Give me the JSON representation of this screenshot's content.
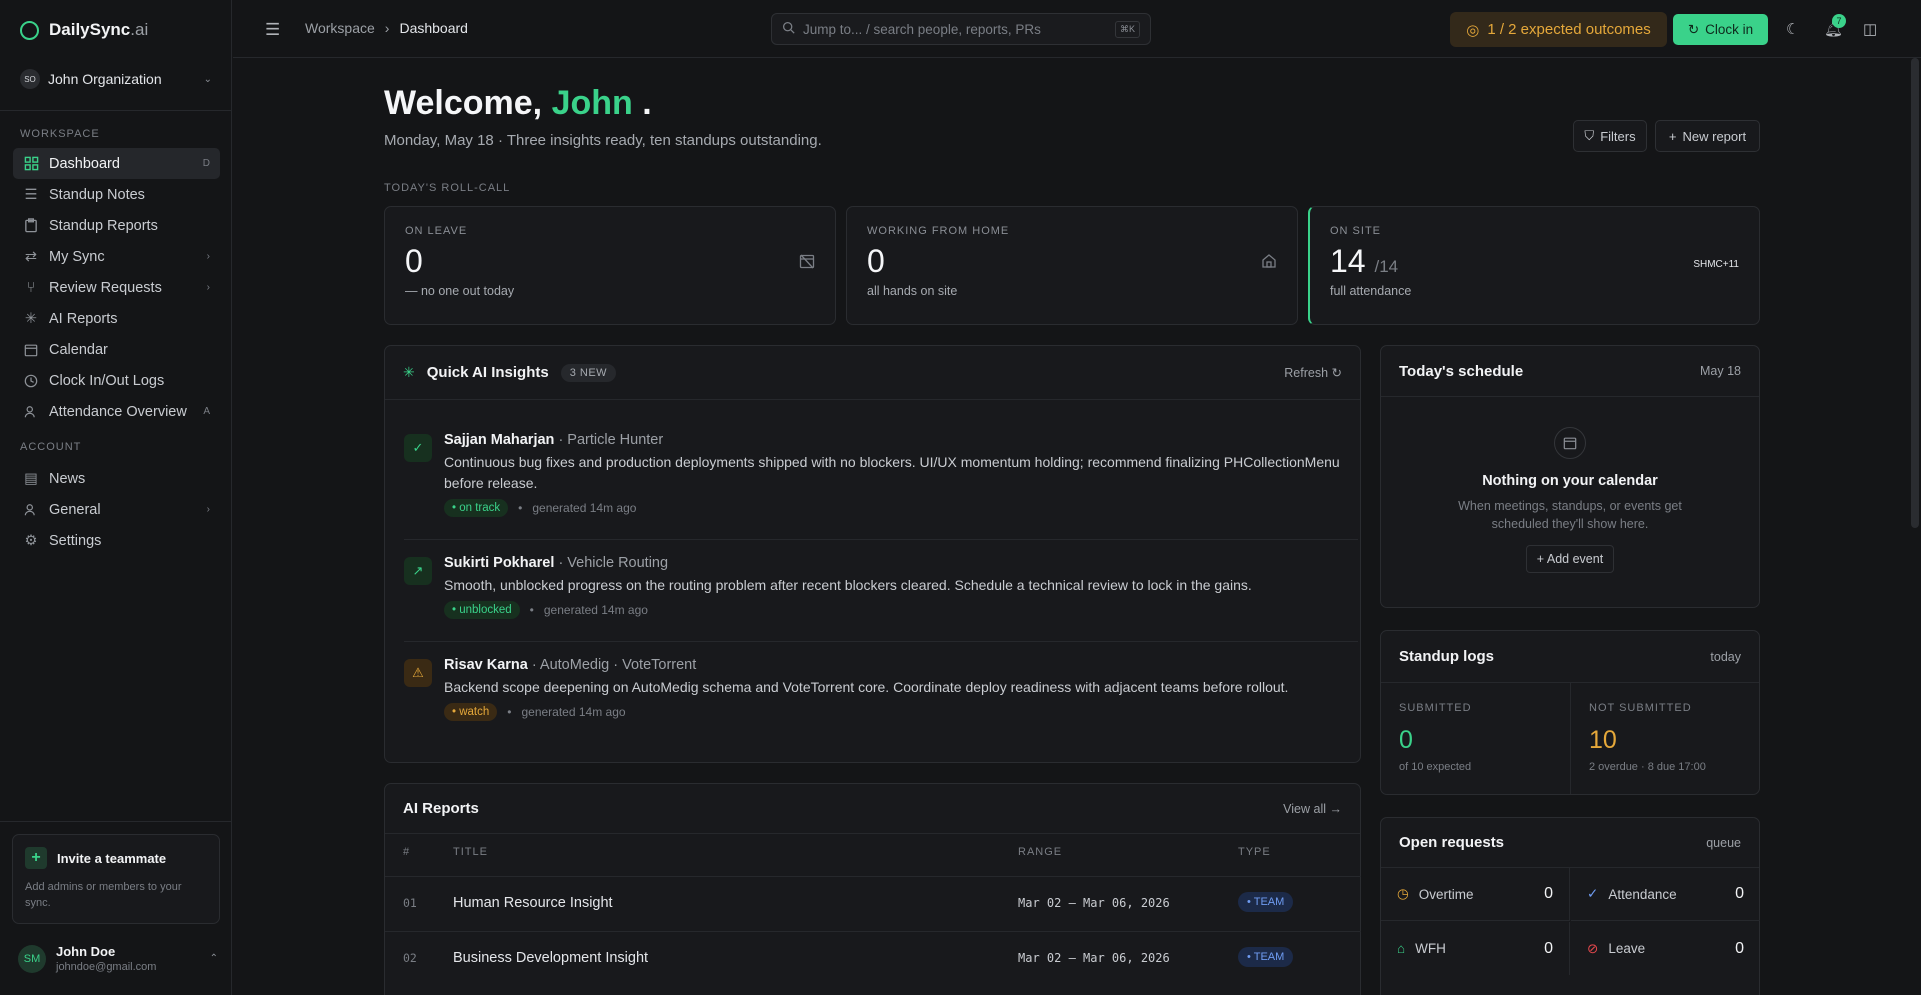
{
  "brand": {
    "name": "DailySync",
    "suffix": ".ai"
  },
  "org": {
    "initials": "SO",
    "name": "John Organization"
  },
  "sidebar": {
    "workspace_label": "WORKSPACE",
    "items": [
      {
        "label": "Dashboard",
        "tail": "D"
      },
      {
        "label": "Standup Notes",
        "tail": ""
      },
      {
        "label": "Standup Reports",
        "tail": ""
      },
      {
        "label": "My Sync",
        "tail": "›"
      },
      {
        "label": "Review Requests",
        "tail": "›"
      },
      {
        "label": "AI Reports",
        "tail": ""
      },
      {
        "label": "Calendar",
        "tail": ""
      },
      {
        "label": "Clock In/Out Logs",
        "tail": ""
      },
      {
        "label": "Attendance Overview",
        "tail": "A"
      }
    ],
    "account_label": "ACCOUNT",
    "account_items": [
      {
        "label": "News",
        "tail": ""
      },
      {
        "label": "General",
        "tail": "›"
      },
      {
        "label": "Settings",
        "tail": ""
      }
    ],
    "invite": {
      "title": "Invite a teammate",
      "desc": "Add admins or members to your sync."
    },
    "user": {
      "initials": "SM",
      "name": "John Doe",
      "email": "johndoe@gmail.com"
    }
  },
  "topbar": {
    "breadcrumb": [
      "Workspace",
      "Dashboard"
    ],
    "search_placeholder": "Jump to...  / search people, reports, PRs",
    "search_kbd": "⌘K",
    "outcomes": "1 / 2 expected outcomes",
    "clockin": "Clock in",
    "notif_count": "7"
  },
  "welcome": {
    "greeting": "Welcome,",
    "name": "John",
    "punct": ".",
    "subtitle": "Monday, May 18 · Three insights ready, ten standups outstanding."
  },
  "actions": {
    "filters": "Filters",
    "new_report": "New report"
  },
  "rollcall": {
    "label": "TODAY'S ROLL-CALL",
    "cards": [
      {
        "label": "ON LEAVE",
        "value": "0",
        "of": "",
        "note": "— no one out today"
      },
      {
        "label": "WORKING FROM HOME",
        "value": "0",
        "of": "",
        "note": "all hands on site"
      },
      {
        "label": "ON SITE",
        "value": "14",
        "of": "/14",
        "note": "full attendance",
        "avatars": "SHMC+11"
      }
    ]
  },
  "insights": {
    "title": "Quick AI Insights",
    "chip": "3 NEW",
    "refresh": "Refresh",
    "items": [
      {
        "name": "Sajjan Maharjan",
        "project": "· Particle Hunter",
        "text": "Continuous bug fixes and production deployments shipped with no blockers. UI/UX momentum holding; recommend finalizing PHCollectionMenu before release.",
        "tag": "on track",
        "time": "generated 14m ago"
      },
      {
        "name": "Sukirti Pokharel",
        "project": "· Vehicle Routing",
        "text": "Smooth, unblocked progress on the routing problem after recent blockers cleared. Schedule a technical review to lock in the gains.",
        "tag": "unblocked",
        "time": "generated 14m ago"
      },
      {
        "name": "Risav Karna",
        "project": "· AutoMedig · VoteTorrent",
        "text": "Backend scope deepening on AutoMedig schema and VoteTorrent core. Coordinate deploy readiness with adjacent teams before rollout.",
        "tag": "watch",
        "time": "generated 14m ago"
      }
    ]
  },
  "reports": {
    "title": "AI Reports",
    "view_all": "View all →",
    "columns": [
      "#",
      "TITLE",
      "RANGE",
      "TYPE"
    ],
    "rows": [
      {
        "n": "01",
        "title": "Human Resource Insight",
        "range": "Mar 02 — Mar 06, 2026",
        "type": "TEAM"
      },
      {
        "n": "02",
        "title": "Business Development Insight",
        "range": "Mar 02 — Mar 06, 2026",
        "type": "TEAM"
      }
    ]
  },
  "schedule": {
    "title": "Today's schedule",
    "date": "May 18",
    "empty_title": "Nothing on your calendar",
    "empty_desc": "When meetings, standups, or events get scheduled they'll show here.",
    "add": "+ Add event"
  },
  "standup": {
    "title": "Standup logs",
    "when": "today",
    "submitted_label": "SUBMITTED",
    "submitted": "0",
    "submitted_note": "of 10 expected",
    "not_label": "NOT SUBMITTED",
    "not": "10",
    "not_note": "2 overdue · 8 due 17:00"
  },
  "requests": {
    "title": "Open requests",
    "queue": "queue",
    "items": [
      {
        "label": "Overtime",
        "count": "0"
      },
      {
        "label": "Attendance",
        "count": "0"
      },
      {
        "label": "WFH",
        "count": "0"
      },
      {
        "label": "Leave",
        "count": "0"
      }
    ]
  },
  "colors": {
    "accent": "#3ad28a",
    "warning": "#e5a83a",
    "danger": "#e5484d",
    "info": "#6f9cf2"
  }
}
